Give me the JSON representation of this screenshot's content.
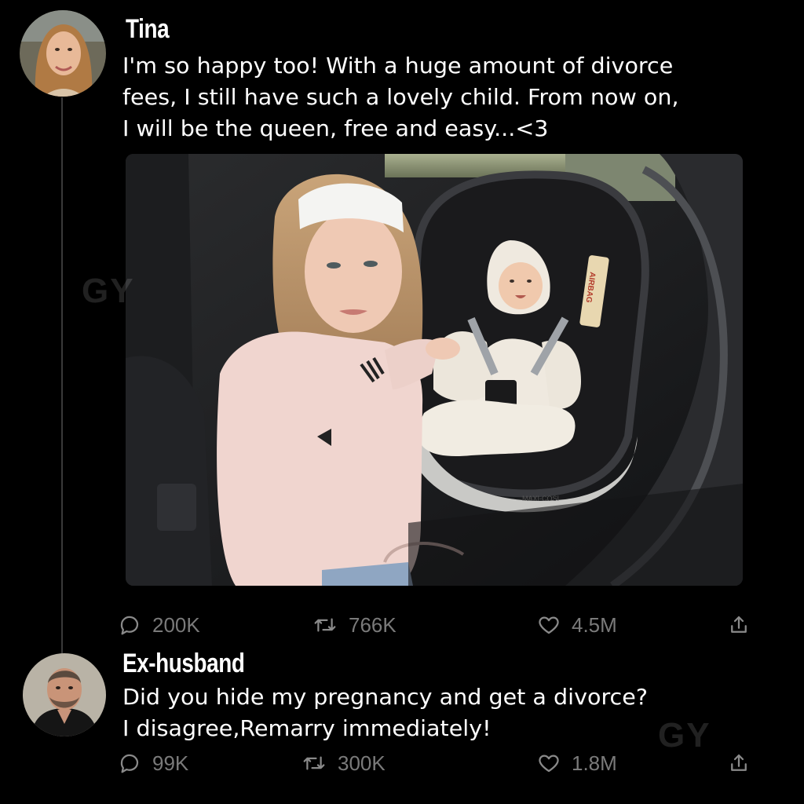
{
  "posts": [
    {
      "author": "Tina",
      "text": "I'm so happy too! With a huge amount of divorce\nfees, I still have such a lovely child. From now on,\nI will be the queen, free and easy...<3",
      "stats": {
        "replies": "200K",
        "retweets": "766K",
        "likes": "4.5M"
      }
    },
    {
      "author": "Ex-husband",
      "text": "Did you hide my pregnancy and get a divorce?\nI disagree,Remarry immediately!",
      "stats": {
        "replies": "99K",
        "retweets": "300K",
        "likes": "1.8M"
      }
    }
  ],
  "photo": {
    "seat_tag": "AIRBAG",
    "seat_brand": "MAXI-COSI"
  },
  "watermark": "GY",
  "icons": {
    "reply": "comment-bubble-icon",
    "retweet": "retweet-icon",
    "like": "heart-icon",
    "share": "share-icon"
  },
  "colors": {
    "background": "#000000",
    "text": "#ffffff",
    "muted": "#7a7a7a"
  }
}
